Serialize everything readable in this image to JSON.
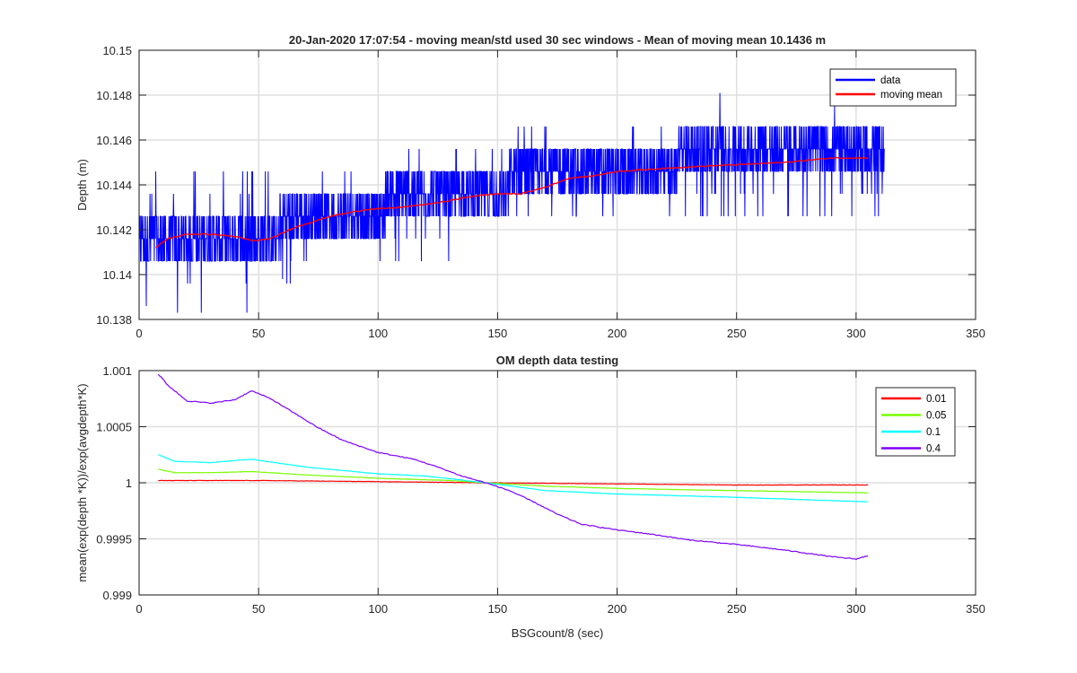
{
  "chart_data": [
    {
      "type": "line",
      "title": "20-Jan-2020 17:07:54 - moving mean/std used 30 sec windows - Mean of moving mean 10.1436 m",
      "xlabel": "",
      "ylabel": "Depth (m)",
      "xlim": [
        0,
        350
      ],
      "ylim": [
        10.138,
        10.15
      ],
      "xticks": [
        0,
        50,
        100,
        150,
        200,
        250,
        300,
        350
      ],
      "xtick_labels": [
        "0",
        "50",
        "100",
        "150",
        "200",
        "250",
        "300",
        "350"
      ],
      "yticks": [
        10.138,
        10.14,
        10.142,
        10.144,
        10.146,
        10.148,
        10.15
      ],
      "ytick_labels": [
        "10.138",
        "10.14",
        "10.142",
        "10.144",
        "10.146",
        "10.148",
        "10.15"
      ],
      "grid": true,
      "legend_position": "top-right",
      "series": [
        {
          "name": "data",
          "color": "#0000ff",
          "style": "noisy-quantized",
          "x_range": [
            0,
            312
          ],
          "outliers": [
            [
              3,
              10.1386
            ],
            [
              16,
              10.1383
            ],
            [
              26,
              10.1383
            ],
            [
              45,
              10.1383
            ],
            [
              60,
              10.1398
            ],
            [
              243,
              10.1481
            ],
            [
              291,
              10.1475
            ]
          ],
          "segments": [
            {
              "x": [
                0,
                60
              ],
              "levels": [
                10.1406,
                10.1416,
                10.1426
              ],
              "weights": [
                0.35,
                0.35,
                0.3
              ],
              "spikes": [
                10.1446,
                10.1436,
                10.1396
              ]
            },
            {
              "x": [
                60,
                103
              ],
              "levels": [
                10.1416,
                10.1426,
                10.1436
              ],
              "weights": [
                0.3,
                0.4,
                0.3
              ],
              "spikes": [
                10.1446,
                10.1406,
                10.1396
              ]
            },
            {
              "x": [
                103,
                155
              ],
              "levels": [
                10.1426,
                10.1436,
                10.1446
              ],
              "weights": [
                0.3,
                0.4,
                0.3
              ],
              "spikes": [
                10.1406,
                10.1416,
                10.1456
              ]
            },
            {
              "x": [
                155,
                225
              ],
              "levels": [
                10.1436,
                10.1446,
                10.1456
              ],
              "weights": [
                0.3,
                0.4,
                0.3
              ],
              "spikes": [
                10.1466,
                10.1426
              ]
            },
            {
              "x": [
                225,
                312
              ],
              "levels": [
                10.1446,
                10.1456,
                10.1466
              ],
              "weights": [
                0.3,
                0.4,
                0.3
              ],
              "spikes": [
                10.1426,
                10.1436
              ]
            }
          ]
        },
        {
          "name": "moving mean",
          "color": "#ff0000",
          "x": [
            7,
            12,
            20,
            30,
            40,
            48,
            55,
            65,
            80,
            95,
            110,
            125,
            140,
            150,
            160,
            170,
            180,
            190,
            200,
            215,
            230,
            250,
            270,
            290,
            305
          ],
          "y": [
            10.1412,
            10.1416,
            10.1418,
            10.1418,
            10.1417,
            10.1415,
            10.1416,
            10.1421,
            10.1426,
            10.1429,
            10.143,
            10.1432,
            10.1435,
            10.1436,
            10.1436,
            10.1439,
            10.1443,
            10.1444,
            10.1446,
            10.1447,
            10.1448,
            10.1449,
            10.145,
            10.1452,
            10.1452
          ]
        }
      ]
    },
    {
      "type": "line",
      "title": "OM depth data testing",
      "xlabel": "BSGcount/8 (sec)",
      "ylabel": "mean(exp(depth *K))/exp(avgdepth*K)",
      "xlim": [
        0,
        350
      ],
      "ylim": [
        0.999,
        1.001
      ],
      "xticks": [
        0,
        50,
        100,
        150,
        200,
        250,
        300,
        350
      ],
      "xtick_labels": [
        "0",
        "50",
        "100",
        "150",
        "200",
        "250",
        "300",
        "350"
      ],
      "yticks": [
        0.999,
        0.9995,
        1,
        1.0005,
        1.001
      ],
      "ytick_labels": [
        "0.999",
        "0.9995",
        "1",
        "1.0005",
        "1.001"
      ],
      "grid": true,
      "legend_position": "top-right",
      "series": [
        {
          "name": "0.01",
          "color": "#ff0000",
          "x": [
            8,
            50,
            100,
            145,
            200,
            250,
            305
          ],
          "y": [
            1.00002,
            1.00002,
            1.00001,
            1.0,
            0.99999,
            0.99998,
            0.99998
          ]
        },
        {
          "name": "0.05",
          "color": "#77ff00",
          "x": [
            8,
            15,
            30,
            47,
            70,
            100,
            130,
            145,
            170,
            200,
            250,
            305
          ],
          "y": [
            1.00012,
            1.00009,
            1.00009,
            1.0001,
            1.00007,
            1.00004,
            1.00002,
            1.0,
            0.99997,
            0.99995,
            0.99993,
            0.99991
          ]
        },
        {
          "name": "0.1",
          "color": "#00ffff",
          "x": [
            8,
            15,
            30,
            47,
            70,
            100,
            120,
            145,
            170,
            200,
            250,
            305
          ],
          "y": [
            1.00025,
            1.00019,
            1.00018,
            1.00021,
            1.00014,
            1.00008,
            1.00006,
            1.0,
            0.99993,
            0.9999,
            0.99987,
            0.99983
          ]
        },
        {
          "name": "0.4",
          "color": "#7f00ff",
          "x": [
            8,
            12,
            20,
            30,
            40,
            47,
            55,
            65,
            75,
            85,
            100,
            115,
            125,
            135,
            145,
            155,
            165,
            175,
            185,
            200,
            215,
            230,
            250,
            270,
            290,
            300,
            305
          ],
          "y": [
            1.00097,
            1.00087,
            1.00073,
            1.00071,
            1.00074,
            1.00082,
            1.00075,
            1.00062,
            1.00049,
            1.00038,
            1.00027,
            1.00021,
            1.00014,
            1.00006,
            1.0,
            0.99993,
            0.99983,
            0.99972,
            0.99963,
            0.99958,
            0.99954,
            0.99949,
            0.99945,
            0.9994,
            0.99934,
            0.99932,
            0.99935
          ]
        }
      ]
    }
  ]
}
